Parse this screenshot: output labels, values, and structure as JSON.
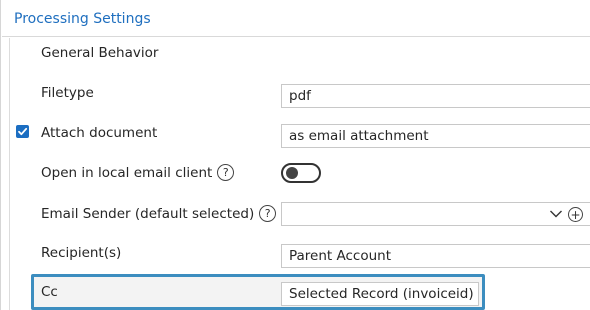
{
  "section": {
    "title": "Processing Settings"
  },
  "general": {
    "heading": "General Behavior"
  },
  "filetype": {
    "label": "Filetype",
    "value": "pdf"
  },
  "attach": {
    "label": "Attach document",
    "checked": true,
    "value": "as email attachment"
  },
  "local_client": {
    "label": "Open in local email client",
    "help": "?",
    "enabled": false
  },
  "sender": {
    "label": "Email Sender (default selected)",
    "help": "?",
    "value": ""
  },
  "recipients": {
    "label": "Recipient(s)",
    "value": "Parent Account"
  },
  "cc": {
    "label": "Cc",
    "value": "Selected Record (invoiceid)"
  },
  "icons": {
    "checkbox": "checkmark-icon",
    "help": "question-circle-icon",
    "dropdown": "chevron-down-icon",
    "add": "plus-circle-icon"
  },
  "colors": {
    "accent": "#1f6fbf",
    "checkbox": "#1b6ec2",
    "highlight": "#3c8dbf"
  }
}
